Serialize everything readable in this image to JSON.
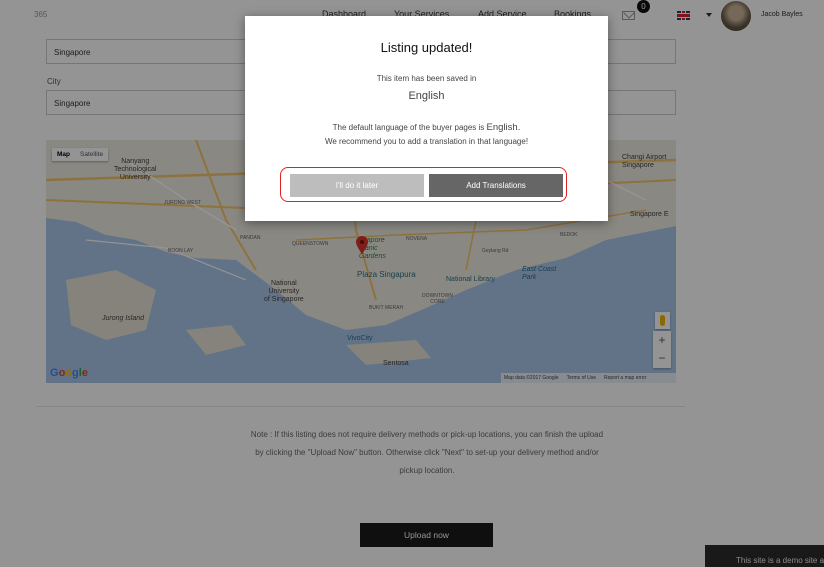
{
  "header": {
    "logo": "365",
    "nav": [
      "Dashboard",
      "Your Services",
      "Add Service",
      "Bookings"
    ],
    "notification_count": "0",
    "user_name": "Jacob Bayles"
  },
  "form": {
    "field1_value": "Singapore",
    "city_label": "City",
    "city_value": "Singapore"
  },
  "map": {
    "tabs": [
      "Map",
      "Satellite"
    ],
    "labels": {
      "nanyang": "Nanyang\nTechnological\nUniversity",
      "jurong_west": "JURONG WEST",
      "jurong_island": "Jurong Island",
      "boon_lay": "BOON LAY",
      "nus": "National\nUniversity\nof Singapore",
      "vivocity": "VivoCity",
      "sentosa": "Sentosa",
      "botanic": "ngapore\notanic\nGardens",
      "plaza": "Plaza Singapura",
      "library": "National Library",
      "east_coast": "East Coast\nPark",
      "changi": "Changi Airport\nSingapore",
      "expo": "Singapore E",
      "novena": "NOVENA",
      "geylang": "Geylang Rd",
      "bedok": "BEDOK",
      "downtown": "DOWNTOWN\nCORE",
      "bukit_merah": "BUKIT MERAH",
      "pandan": "PANDAN",
      "queenstown": "QUEENSTOWN"
    },
    "attribution": [
      "Map data ©2017 Google",
      "Terms of Use",
      "Report a map error"
    ],
    "zoom_in": "+",
    "zoom_out": "−"
  },
  "note": "Note : If this listing does not require delivery methods or pick-up locations, you can finish the upload by clicking the \"Upload Now\" button. Otherwise click \"Next\" to set-up your delivery method and/or pickup location.",
  "upload_button": "Upload now",
  "demo_banner": "This site is a demo site a",
  "modal": {
    "title": "Listing updated!",
    "saved_text": "This item has been saved in",
    "language": "English",
    "default_lang_prefix": "The default language of the buyer pages is",
    "default_lang_value": "English.",
    "recommend_text": "We recommend you to add a translation in that language!",
    "later_button": "I'll do it later",
    "translate_button": "Add Translations"
  },
  "colors": {
    "highlight": "#e0221e",
    "later_button": "#bdbdbd",
    "translate_button": "#666666",
    "water": "#a9c7e8"
  }
}
